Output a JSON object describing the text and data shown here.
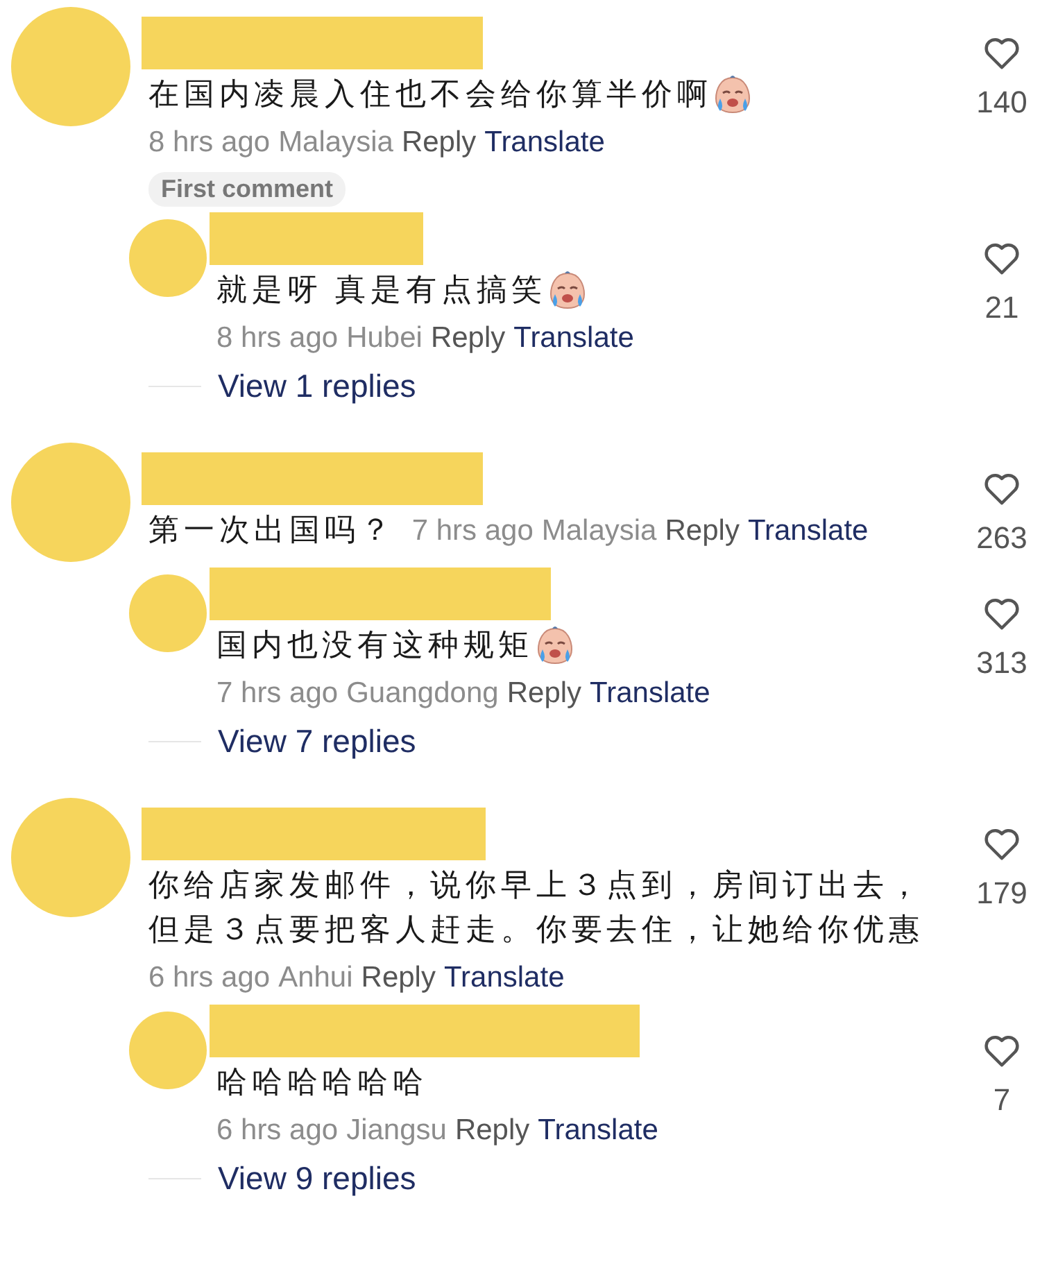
{
  "threads": [
    {
      "comment": {
        "text": "在国内凌晨入住也不会给你算半价啊",
        "emoji": true,
        "meta_inline": false,
        "time": "8 hrs ago",
        "location": "Malaysia",
        "reply": "Reply",
        "translate": "Translate",
        "likes": "140"
      },
      "badge": "First comment",
      "replies": [
        {
          "text": "就是呀 真是有点搞笑",
          "emoji": true,
          "meta_inline": false,
          "time": "8 hrs ago",
          "location": "Hubei",
          "reply": "Reply",
          "translate": "Translate",
          "likes": "21"
        }
      ],
      "view_more": "View 1 replies"
    },
    {
      "comment": {
        "text": "第一次出国吗？",
        "emoji": false,
        "meta_inline": true,
        "time": "7 hrs ago",
        "location": "Malaysia",
        "reply": "Reply",
        "translate": "Translate",
        "likes": "263"
      },
      "replies": [
        {
          "text": "国内也没有这种规矩",
          "emoji": true,
          "meta_inline": false,
          "time": "7 hrs ago",
          "location": "Guangdong",
          "reply": "Reply",
          "translate": "Translate",
          "likes": "313"
        }
      ],
      "view_more": "View 7 replies"
    },
    {
      "comment": {
        "text": "你给店家发邮件，说你早上３点到，房间订出去，但是３点要把客人赶走。你要去住，让她给你优惠",
        "emoji": false,
        "meta_inline": false,
        "time": "6 hrs ago",
        "location": "Anhui",
        "reply": "Reply",
        "translate": "Translate",
        "likes": "179"
      },
      "replies": [
        {
          "text": "哈哈哈哈哈哈",
          "emoji": false,
          "meta_inline": false,
          "time": "6 hrs ago",
          "location": "Jiangsu",
          "reply": "Reply",
          "translate": "Translate",
          "likes": "7"
        }
      ],
      "view_more": "View 9 replies"
    }
  ]
}
